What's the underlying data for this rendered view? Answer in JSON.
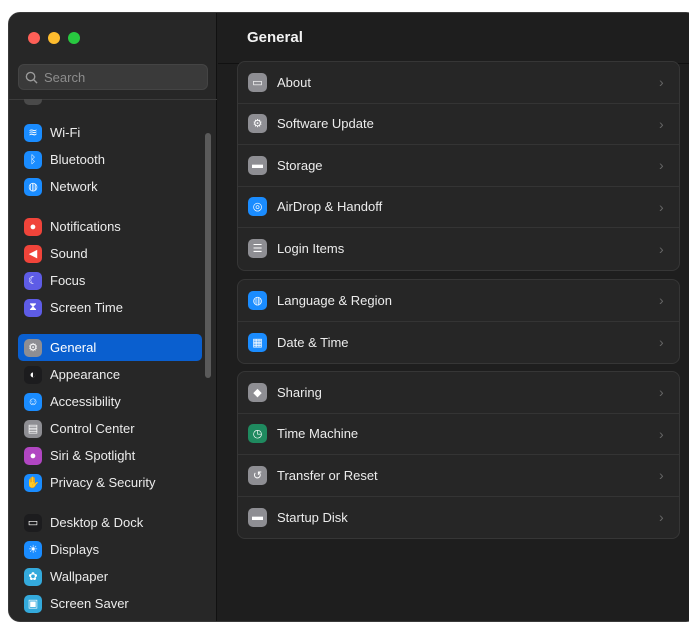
{
  "search": {
    "placeholder": "Search"
  },
  "sidebar": {
    "groups": [
      [
        {
          "label": "Wi-Fi",
          "icon": "wifi-icon",
          "color": "#1a8cff"
        },
        {
          "label": "Bluetooth",
          "icon": "bluetooth-icon",
          "color": "#1a8cff"
        },
        {
          "label": "Network",
          "icon": "globe-icon",
          "color": "#1a8cff"
        }
      ],
      [
        {
          "label": "Notifications",
          "icon": "bell-icon",
          "color": "#f0443a"
        },
        {
          "label": "Sound",
          "icon": "speaker-icon",
          "color": "#f0443a"
        },
        {
          "label": "Focus",
          "icon": "moon-icon",
          "color": "#5e5ce6"
        },
        {
          "label": "Screen Time",
          "icon": "hourglass-icon",
          "color": "#5e5ce6"
        }
      ],
      [
        {
          "label": "General",
          "icon": "gear-icon",
          "color": "#8e8e93",
          "selected": true
        },
        {
          "label": "Appearance",
          "icon": "appearance-icon",
          "color": "#1c1c1e"
        },
        {
          "label": "Accessibility",
          "icon": "accessibility-icon",
          "color": "#1a8cff"
        },
        {
          "label": "Control Center",
          "icon": "control-center-icon",
          "color": "#8e8e93"
        },
        {
          "label": "Siri & Spotlight",
          "icon": "siri-icon",
          "color": "#b146c2"
        },
        {
          "label": "Privacy & Security",
          "icon": "hand-icon",
          "color": "#1a8cff"
        }
      ],
      [
        {
          "label": "Desktop & Dock",
          "icon": "dock-icon",
          "color": "#1c1c1e"
        },
        {
          "label": "Displays",
          "icon": "sun-icon",
          "color": "#1a8cff"
        },
        {
          "label": "Wallpaper",
          "icon": "wallpaper-icon",
          "color": "#34aadc"
        },
        {
          "label": "Screen Saver",
          "icon": "screen-saver-icon",
          "color": "#34aadc"
        }
      ]
    ]
  },
  "main": {
    "title": "General",
    "cards": [
      [
        {
          "label": "About",
          "icon": "about-icon",
          "color": "#8e8e93"
        },
        {
          "label": "Software Update",
          "icon": "gear-badge-icon",
          "color": "#8e8e93"
        },
        {
          "label": "Storage",
          "icon": "storage-icon",
          "color": "#8e8e93"
        },
        {
          "label": "AirDrop & Handoff",
          "icon": "airdrop-icon",
          "color": "#1a8cff"
        },
        {
          "label": "Login Items",
          "icon": "list-icon",
          "color": "#8e8e93"
        }
      ],
      [
        {
          "label": "Language & Region",
          "icon": "globe-icon",
          "color": "#1a8cff"
        },
        {
          "label": "Date & Time",
          "icon": "calendar-clock-icon",
          "color": "#1a8cff"
        }
      ],
      [
        {
          "label": "Sharing",
          "icon": "sharing-icon",
          "color": "#8e8e93"
        },
        {
          "label": "Time Machine",
          "icon": "time-machine-icon",
          "color": "#1f8a5f"
        },
        {
          "label": "Transfer or Reset",
          "icon": "reset-icon",
          "color": "#8e8e93"
        },
        {
          "label": "Startup Disk",
          "icon": "disk-icon",
          "color": "#8e8e93"
        }
      ]
    ]
  }
}
